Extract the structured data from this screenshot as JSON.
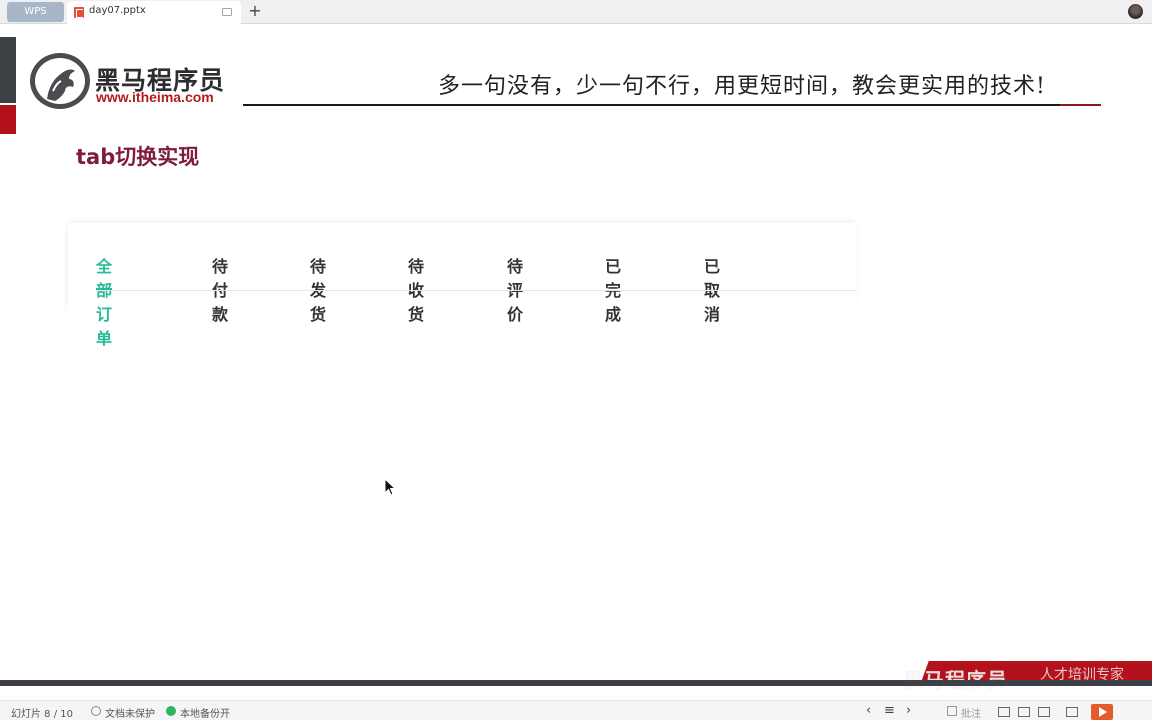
{
  "titlebar": {
    "app_tab": "WPS",
    "doc_tab": "day07.pptx",
    "new_tab": "+"
  },
  "slide": {
    "logo_name": "黑马程序员",
    "logo_url": "www.itheima.com",
    "slogan": "多一句没有，少一句不行，用更短时间，教会更实用的技术!",
    "title": "tab切换实现",
    "tabs": [
      {
        "label": "全部订单",
        "active": true
      },
      {
        "label": "待付款",
        "active": false
      },
      {
        "label": "待发货",
        "active": false
      },
      {
        "label": "待收货",
        "active": false
      },
      {
        "label": "待评价",
        "active": false
      },
      {
        "label": "已完成",
        "active": false
      },
      {
        "label": "已取消",
        "active": false
      }
    ],
    "active_color": "#27ba9b",
    "watermark": "黑马程序员",
    "watermark_sub": "人才培训专家"
  },
  "statusbar": {
    "slide_counter": "幻灯片 8 / 10",
    "protection": "文档未保护",
    "backup": "本地备份开",
    "comment": "批注"
  },
  "icons": {
    "prev": "chevron-left-icon",
    "next": "chevron-right-icon",
    "play": "play-icon"
  }
}
